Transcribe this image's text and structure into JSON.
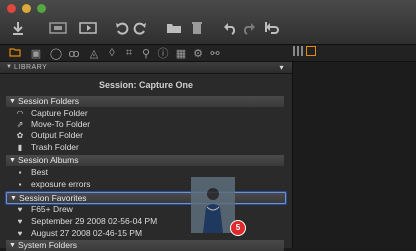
{
  "toolbar": {
    "buttons": [
      {
        "name": "import-button",
        "icon": "download-arrow-icon"
      },
      {
        "name": "capture-button",
        "icon": "capture-icon"
      },
      {
        "name": "process-button",
        "icon": "process-icon"
      },
      {
        "name": "rotate-left-button",
        "icon": "rotate-left-icon"
      },
      {
        "name": "rotate-right-button",
        "icon": "rotate-right-icon"
      },
      {
        "name": "folder-button",
        "icon": "folder-icon"
      },
      {
        "name": "trash-button",
        "icon": "trash-icon"
      },
      {
        "name": "undo-button",
        "icon": "undo-icon"
      },
      {
        "name": "redo-button",
        "icon": "redo-icon"
      },
      {
        "name": "reset-button",
        "icon": "reset-icon"
      }
    ]
  },
  "tools": [
    "folder-icon",
    "camera-icon",
    "magnifier-icon",
    "color-circles-icon",
    "exposure-icon",
    "lens-icon",
    "crop-icon",
    "search-icon",
    "info-icon",
    "grid-icon",
    "gear-icon",
    "settings-icon"
  ],
  "library": {
    "header": "LIBRARY",
    "session_title": "Session: Capture One",
    "sections": [
      {
        "label": "Session Folders"
      },
      {
        "label": "Session Albums"
      },
      {
        "label": "Session Favorites"
      },
      {
        "label": "System Folders"
      }
    ],
    "folders": [
      {
        "label": "Capture Folder"
      },
      {
        "label": "Move-To Folder"
      },
      {
        "label": "Output Folder"
      },
      {
        "label": "Trash Folder"
      }
    ],
    "albums": [
      {
        "label": "Best"
      },
      {
        "label": "exposure errors"
      }
    ],
    "favorites": [
      {
        "label": "F65+ Drew"
      },
      {
        "label": "September 29 2008 02-56-04 PM"
      },
      {
        "label": "August 27 2008 02-46-15 PM"
      }
    ]
  },
  "drag": {
    "count": "5"
  },
  "colors": {
    "accent": "#e68a00",
    "badge": "#e02a2a",
    "selection": "#5a7fd0"
  }
}
